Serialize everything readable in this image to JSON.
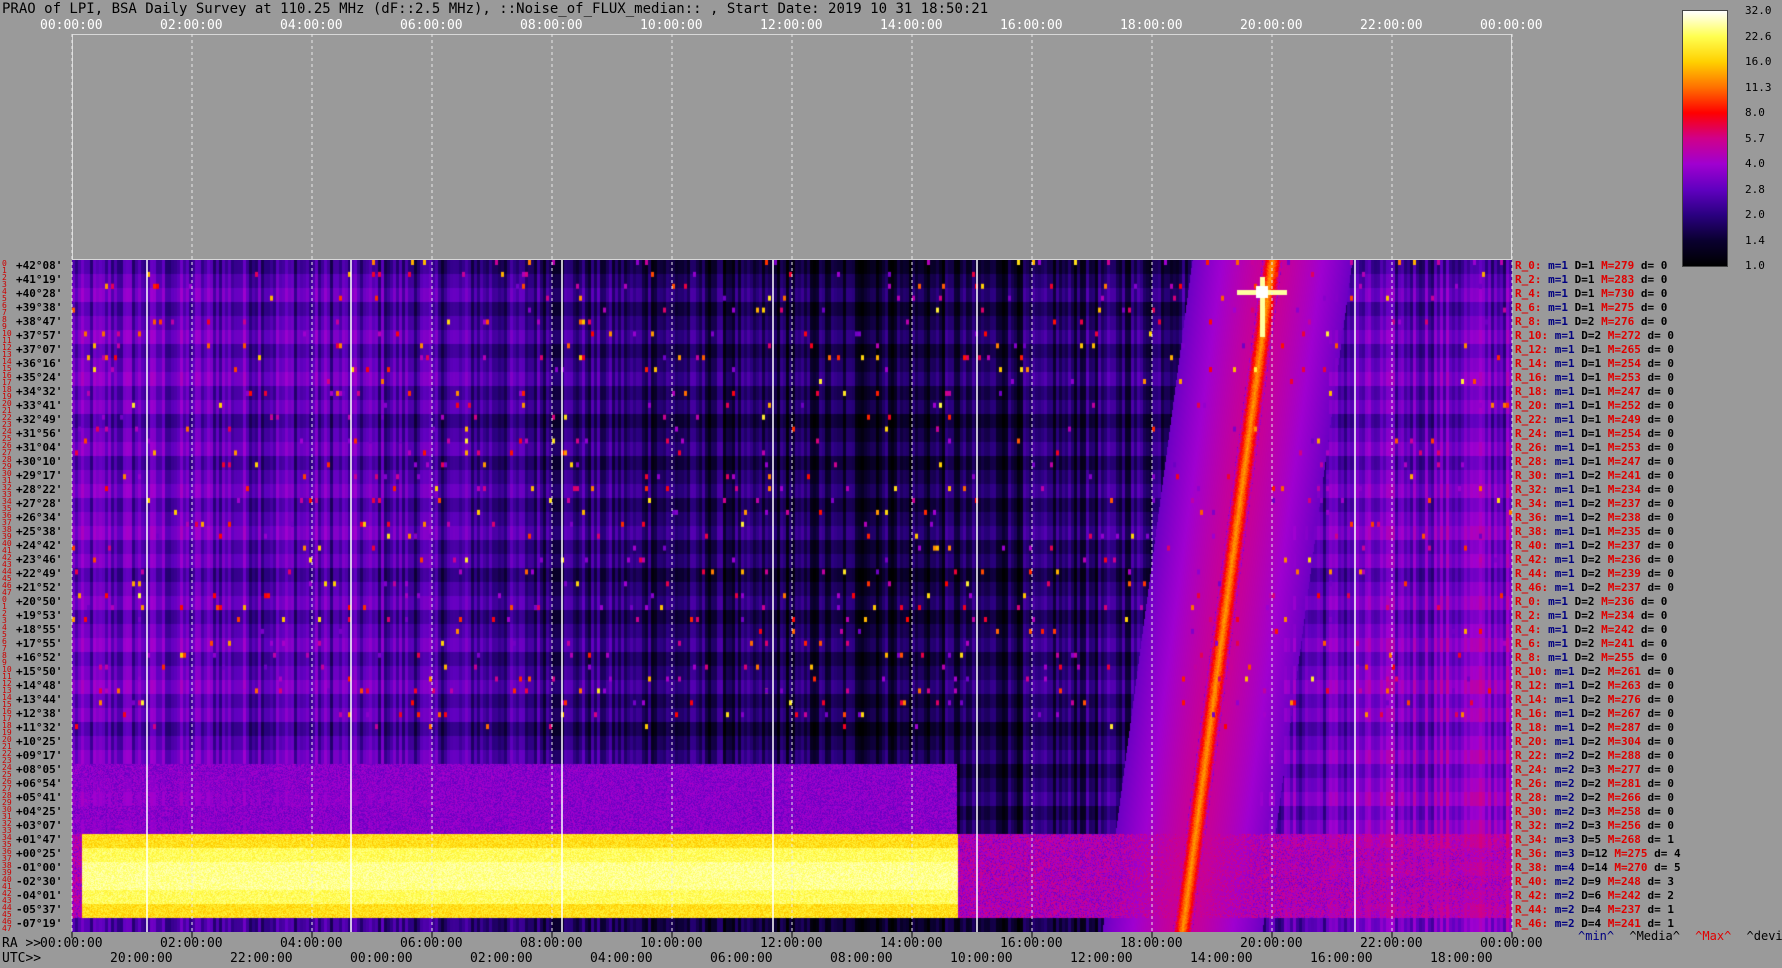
{
  "title": "PRAO of LPI, BSA Daily Survey at 110.25 MHz (dF::2.5 MHz), ::Noise_of_FLUX_median:: , Start Date: 2019 10 31 18:50:21",
  "top_axis": [
    "00:00:00",
    "02:00:00",
    "04:00:00",
    "06:00:00",
    "08:00:00",
    "10:00:00",
    "12:00:00",
    "14:00:00",
    "16:00:00",
    "18:00:00",
    "20:00:00",
    "22:00:00",
    "00:00:00"
  ],
  "ra_axis_label": "RA >>",
  "ra_axis": [
    "00:00:00",
    "02:00:00",
    "04:00:00",
    "06:00:00",
    "08:00:00",
    "10:00:00",
    "12:00:00",
    "14:00:00",
    "16:00:00",
    "18:00:00",
    "20:00:00",
    "22:00:00",
    "00:00:00"
  ],
  "utc_axis_label": "UTC>>",
  "utc_axis": [
    "20:00:00",
    "22:00:00",
    "00:00:00",
    "02:00:00",
    "04:00:00",
    "06:00:00",
    "08:00:00",
    "10:00:00",
    "12:00:00",
    "14:00:00",
    "16:00:00",
    "18:00:00"
  ],
  "colorbar": {
    "ticks": [
      "32.0",
      "22.6",
      "16.0",
      "11.3",
      "8.0",
      "5.7",
      "4.0",
      "2.8",
      "2.0",
      "1.4",
      "1.0"
    ],
    "stops": [
      "#ffffff",
      "#ffff50",
      "#ffd000",
      "#ff7000",
      "#ff0000",
      "#d0008a",
      "#a000d0",
      "#6000c0",
      "#2a0080",
      "#0a0030",
      "#000000"
    ]
  },
  "legend": {
    "min": "^min^",
    "media": "^Media^",
    "max": "^Max^",
    "devia": "^devia^",
    "min_color": "#000080",
    "max_color": "#e00000",
    "media_color": "#000000",
    "devia_color": "#000000"
  },
  "row_numbers": [
    "0",
    "1",
    "2",
    "3",
    "4",
    "5",
    "6",
    "7",
    "8",
    "9",
    "10",
    "11",
    "12",
    "13",
    "14",
    "15",
    "16",
    "17",
    "18",
    "19",
    "20",
    "21",
    "22",
    "23",
    "24",
    "25",
    "26",
    "27",
    "28",
    "29",
    "30",
    "31",
    "32",
    "33",
    "34",
    "35",
    "36",
    "37",
    "38",
    "39",
    "40",
    "41",
    "42",
    "43",
    "44",
    "45",
    "46",
    "47",
    "0",
    "1",
    "2",
    "3",
    "4",
    "5",
    "6",
    "7",
    "8",
    "9",
    "10",
    "11",
    "12",
    "13",
    "14",
    "15",
    "16",
    "17",
    "18",
    "19",
    "20",
    "21",
    "22",
    "23",
    "24",
    "25",
    "26",
    "27",
    "28",
    "29",
    "30",
    "31",
    "32",
    "33",
    "34",
    "35",
    "36",
    "37",
    "38",
    "39",
    "40",
    "41",
    "42",
    "43",
    "44",
    "45",
    "46",
    "47"
  ],
  "declinations": [
    "+42°08'",
    "+41°19'",
    "+40°28'",
    "+39°38'",
    "+38°47'",
    "+37°57'",
    "+37°07'",
    "+36°16'",
    "+35°24'",
    "+34°32'",
    "+33°41'",
    "+32°49'",
    "+31°56'",
    "+31°04'",
    "+30°10'",
    "+29°17'",
    "+28°22'",
    "+27°28'",
    "+26°34'",
    "+25°38'",
    "+24°42'",
    "+23°46'",
    "+22°49'",
    "+21°52'",
    "+20°50'",
    "+19°53'",
    "+18°55'",
    "+17°55'",
    "+16°52'",
    "+15°50'",
    "+14°48'",
    "+13°44'",
    "+12°38'",
    "+11°32'",
    "+10°25'",
    "+09°17'",
    "+08°05'",
    "+06°54'",
    "+05°41'",
    "+04°25'",
    "+03°07'",
    "+01°47'",
    "+00°25'",
    "-01°00'",
    "-02°30'",
    "-04°01'",
    "-05°37'",
    "-07°19'"
  ],
  "rows": [
    [
      "R_0:",
      "m=1",
      "D=1",
      "M=279",
      "d= 0"
    ],
    [
      "R_2:",
      "m=1",
      "D=1",
      "M=283",
      "d= 0"
    ],
    [
      "R_4:",
      "m=1",
      "D=1",
      "M=730",
      "d= 0"
    ],
    [
      "R_6:",
      "m=1",
      "D=1",
      "M=275",
      "d= 0"
    ],
    [
      "R_8:",
      "m=1",
      "D=2",
      "M=276",
      "d= 0"
    ],
    [
      "R_10:",
      "m=1",
      "D=2",
      "M=272",
      "d= 0"
    ],
    [
      "R_12:",
      "m=1",
      "D=1",
      "M=265",
      "d= 0"
    ],
    [
      "R_14:",
      "m=1",
      "D=1",
      "M=254",
      "d= 0"
    ],
    [
      "R_16:",
      "m=1",
      "D=1",
      "M=253",
      "d= 0"
    ],
    [
      "R_18:",
      "m=1",
      "D=1",
      "M=247",
      "d= 0"
    ],
    [
      "R_20:",
      "m=1",
      "D=1",
      "M=252",
      "d= 0"
    ],
    [
      "R_22:",
      "m=1",
      "D=1",
      "M=249",
      "d= 0"
    ],
    [
      "R_24:",
      "m=1",
      "D=1",
      "M=254",
      "d= 0"
    ],
    [
      "R_26:",
      "m=1",
      "D=1",
      "M=253",
      "d= 0"
    ],
    [
      "R_28:",
      "m=1",
      "D=1",
      "M=247",
      "d= 0"
    ],
    [
      "R_30:",
      "m=1",
      "D=2",
      "M=241",
      "d= 0"
    ],
    [
      "R_32:",
      "m=1",
      "D=1",
      "M=234",
      "d= 0"
    ],
    [
      "R_34:",
      "m=1",
      "D=2",
      "M=237",
      "d= 0"
    ],
    [
      "R_36:",
      "m=1",
      "D=2",
      "M=238",
      "d= 0"
    ],
    [
      "R_38:",
      "m=1",
      "D=1",
      "M=235",
      "d= 0"
    ],
    [
      "R_40:",
      "m=1",
      "D=2",
      "M=237",
      "d= 0"
    ],
    [
      "R_42:",
      "m=1",
      "D=2",
      "M=236",
      "d= 0"
    ],
    [
      "R_44:",
      "m=1",
      "D=2",
      "M=239",
      "d= 0"
    ],
    [
      "R_46:",
      "m=1",
      "D=2",
      "M=237",
      "d= 0"
    ],
    [
      "R_0:",
      "m=1",
      "D=2",
      "M=236",
      "d= 0"
    ],
    [
      "R_2:",
      "m=1",
      "D=2",
      "M=234",
      "d= 0"
    ],
    [
      "R_4:",
      "m=1",
      "D=2",
      "M=242",
      "d= 0"
    ],
    [
      "R_6:",
      "m=1",
      "D=2",
      "M=241",
      "d= 0"
    ],
    [
      "R_8:",
      "m=1",
      "D=2",
      "M=255",
      "d= 0"
    ],
    [
      "R_10:",
      "m=1",
      "D=2",
      "M=261",
      "d= 0"
    ],
    [
      "R_12:",
      "m=1",
      "D=2",
      "M=263",
      "d= 0"
    ],
    [
      "R_14:",
      "m=1",
      "D=2",
      "M=276",
      "d= 0"
    ],
    [
      "R_16:",
      "m=1",
      "D=2",
      "M=267",
      "d= 0"
    ],
    [
      "R_18:",
      "m=1",
      "D=2",
      "M=287",
      "d= 0"
    ],
    [
      "R_20:",
      "m=1",
      "D=2",
      "M=304",
      "d= 0"
    ],
    [
      "R_22:",
      "m=2",
      "D=2",
      "M=288",
      "d= 0"
    ],
    [
      "R_24:",
      "m=2",
      "D=3",
      "M=277",
      "d= 0"
    ],
    [
      "R_26:",
      "m=2",
      "D=2",
      "M=281",
      "d= 0"
    ],
    [
      "R_28:",
      "m=2",
      "D=2",
      "M=266",
      "d= 0"
    ],
    [
      "R_30:",
      "m=2",
      "D=3",
      "M=258",
      "d= 0"
    ],
    [
      "R_32:",
      "m=2",
      "D=3",
      "M=256",
      "d= 0"
    ],
    [
      "R_34:",
      "m=3",
      "D=5",
      "M=268",
      "d= 1"
    ],
    [
      "R_36:",
      "m=3",
      "D=12",
      "M=275",
      "d= 4"
    ],
    [
      "R_38:",
      "m=4",
      "D=14",
      "M=270",
      "d= 5"
    ],
    [
      "R_40:",
      "m=2",
      "D=9",
      "M=248",
      "d= 3"
    ],
    [
      "R_42:",
      "m=2",
      "D=6",
      "M=242",
      "d= 2"
    ],
    [
      "R_44:",
      "m=2",
      "D=4",
      "M=237",
      "d= 1"
    ],
    [
      "R_46:",
      "m=2",
      "D=4",
      "M=241",
      "d= 1"
    ]
  ],
  "chart_data": {
    "type": "heatmap",
    "title": "PRAO of LPI, BSA Daily Survey at 110.25 MHz (dF::2.5 MHz), ::Noise_of_FLUX_median:: , Start Date: 2019 10 31 18:50:21",
    "x_axis_top": "00:00:00 – 00:00:00 (2 h steps)",
    "x_axis_ra_range": [
      "00:00:00",
      "24:00:00"
    ],
    "x_axis_utc_start": "18:50:21",
    "y_axis_dec_range": [
      "+42°08'",
      "-07°19'"
    ],
    "n_rows": 48,
    "colorbar_range": [
      1.0,
      32.0
    ],
    "colorbar_scale": "log",
    "features": [
      {
        "name": "bright band",
        "dec_range": [
          "+01°47'",
          "-05°37'"
        ],
        "ra_range": [
          "00:10:00",
          "14:45:00"
        ],
        "level": 22.6
      },
      {
        "name": "moving track",
        "ra_start": "18:30:00",
        "ra_end": "20:00:00",
        "dec_start": "-07°19'",
        "dec_end": "+42°08'",
        "level": 11.3
      },
      {
        "name": "bright source",
        "ra": "19:50:00",
        "dec": "+40°28'",
        "level": 32.0
      }
    ]
  }
}
